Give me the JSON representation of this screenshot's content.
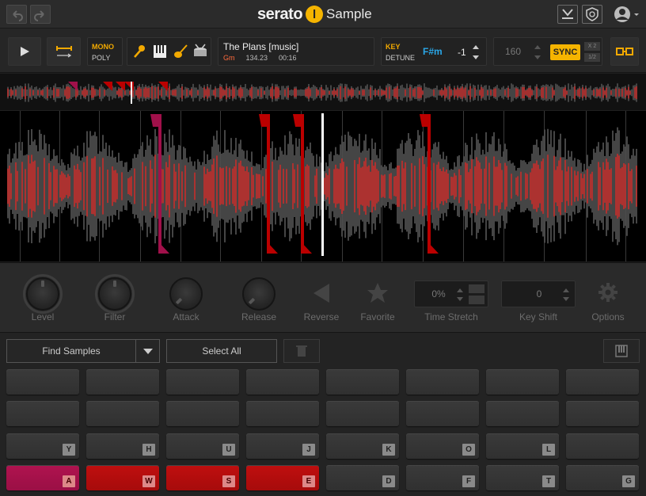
{
  "app": {
    "logo_word": "serato",
    "logo_mark": "l",
    "product": "Sample"
  },
  "deck": {
    "mode_mono": "MONO",
    "mode_poly": "POLY",
    "track_title": "The Plans [music]",
    "track_key": "Gm",
    "track_bpm": "134.23",
    "track_time": "00:16",
    "key_label": "KEY",
    "detune_label": "DETUNE",
    "key_value": "F#m",
    "key_shift": "-1",
    "bpm_value": "160",
    "sync_label": "SYNC",
    "x2_label": "X 2",
    "half_label": "1/2"
  },
  "controls": {
    "level": "Level",
    "filter": "Filter",
    "attack": "Attack",
    "release": "Release",
    "reverse": "Reverse",
    "favorite": "Favorite",
    "time_stretch_label": "Time Stretch",
    "time_stretch_value": "0%",
    "key_shift_label": "Key Shift",
    "key_shift_value": "0",
    "options": "Options"
  },
  "pads_toolbar": {
    "find_samples": "Find Samples",
    "select_all": "Select All"
  },
  "pads": {
    "row3": [
      "Y",
      "H",
      "U",
      "J",
      "K",
      "O",
      "L",
      ""
    ],
    "row4": [
      "A",
      "W",
      "S",
      "E",
      "D",
      "F",
      "T",
      "G"
    ]
  },
  "colors": {
    "accent_yellow": "#f5b400",
    "key_blue": "#2aa7e8",
    "waveform_red": "#c8302e",
    "pad_pink": "#b0134f",
    "pad_red": "#c00f0f"
  }
}
